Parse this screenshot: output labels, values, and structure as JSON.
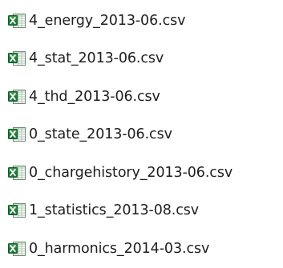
{
  "files": [
    {
      "name": "4_energy_2013-06.csv",
      "icon": "excel-csv-file-icon"
    },
    {
      "name": "4_stat_2013-06.csv",
      "icon": "excel-csv-file-icon"
    },
    {
      "name": "4_thd_2013-06.csv",
      "icon": "excel-csv-file-icon"
    },
    {
      "name": "0_state_2013-06.csv",
      "icon": "excel-csv-file-icon"
    },
    {
      "name": "0_chargehistory_2013-06.csv",
      "icon": "excel-csv-file-icon"
    },
    {
      "name": "1_statistics_2013-08.csv",
      "icon": "excel-csv-file-icon"
    },
    {
      "name": "0_harmonics_2014-03.csv",
      "icon": "excel-csv-file-icon"
    }
  ],
  "colors": {
    "icon_green": "#1d7a3a",
    "icon_green_light": "#5cb85c",
    "text": "#1e1e1e"
  }
}
